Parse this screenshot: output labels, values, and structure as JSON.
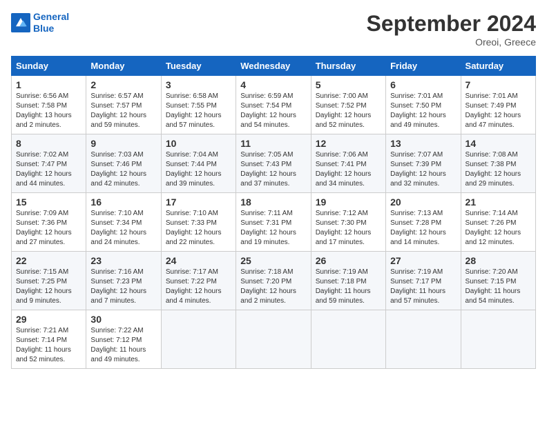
{
  "header": {
    "logo_line1": "General",
    "logo_line2": "Blue",
    "month_title": "September 2024",
    "location": "Oreoi, Greece"
  },
  "weekdays": [
    "Sunday",
    "Monday",
    "Tuesday",
    "Wednesday",
    "Thursday",
    "Friday",
    "Saturday"
  ],
  "weeks": [
    [
      {
        "day": "1",
        "sunrise": "Sunrise: 6:56 AM",
        "sunset": "Sunset: 7:58 PM",
        "daylight": "Daylight: 13 hours and 2 minutes."
      },
      {
        "day": "2",
        "sunrise": "Sunrise: 6:57 AM",
        "sunset": "Sunset: 7:57 PM",
        "daylight": "Daylight: 12 hours and 59 minutes."
      },
      {
        "day": "3",
        "sunrise": "Sunrise: 6:58 AM",
        "sunset": "Sunset: 7:55 PM",
        "daylight": "Daylight: 12 hours and 57 minutes."
      },
      {
        "day": "4",
        "sunrise": "Sunrise: 6:59 AM",
        "sunset": "Sunset: 7:54 PM",
        "daylight": "Daylight: 12 hours and 54 minutes."
      },
      {
        "day": "5",
        "sunrise": "Sunrise: 7:00 AM",
        "sunset": "Sunset: 7:52 PM",
        "daylight": "Daylight: 12 hours and 52 minutes."
      },
      {
        "day": "6",
        "sunrise": "Sunrise: 7:01 AM",
        "sunset": "Sunset: 7:50 PM",
        "daylight": "Daylight: 12 hours and 49 minutes."
      },
      {
        "day": "7",
        "sunrise": "Sunrise: 7:01 AM",
        "sunset": "Sunset: 7:49 PM",
        "daylight": "Daylight: 12 hours and 47 minutes."
      }
    ],
    [
      {
        "day": "8",
        "sunrise": "Sunrise: 7:02 AM",
        "sunset": "Sunset: 7:47 PM",
        "daylight": "Daylight: 12 hours and 44 minutes."
      },
      {
        "day": "9",
        "sunrise": "Sunrise: 7:03 AM",
        "sunset": "Sunset: 7:46 PM",
        "daylight": "Daylight: 12 hours and 42 minutes."
      },
      {
        "day": "10",
        "sunrise": "Sunrise: 7:04 AM",
        "sunset": "Sunset: 7:44 PM",
        "daylight": "Daylight: 12 hours and 39 minutes."
      },
      {
        "day": "11",
        "sunrise": "Sunrise: 7:05 AM",
        "sunset": "Sunset: 7:43 PM",
        "daylight": "Daylight: 12 hours and 37 minutes."
      },
      {
        "day": "12",
        "sunrise": "Sunrise: 7:06 AM",
        "sunset": "Sunset: 7:41 PM",
        "daylight": "Daylight: 12 hours and 34 minutes."
      },
      {
        "day": "13",
        "sunrise": "Sunrise: 7:07 AM",
        "sunset": "Sunset: 7:39 PM",
        "daylight": "Daylight: 12 hours and 32 minutes."
      },
      {
        "day": "14",
        "sunrise": "Sunrise: 7:08 AM",
        "sunset": "Sunset: 7:38 PM",
        "daylight": "Daylight: 12 hours and 29 minutes."
      }
    ],
    [
      {
        "day": "15",
        "sunrise": "Sunrise: 7:09 AM",
        "sunset": "Sunset: 7:36 PM",
        "daylight": "Daylight: 12 hours and 27 minutes."
      },
      {
        "day": "16",
        "sunrise": "Sunrise: 7:10 AM",
        "sunset": "Sunset: 7:34 PM",
        "daylight": "Daylight: 12 hours and 24 minutes."
      },
      {
        "day": "17",
        "sunrise": "Sunrise: 7:10 AM",
        "sunset": "Sunset: 7:33 PM",
        "daylight": "Daylight: 12 hours and 22 minutes."
      },
      {
        "day": "18",
        "sunrise": "Sunrise: 7:11 AM",
        "sunset": "Sunset: 7:31 PM",
        "daylight": "Daylight: 12 hours and 19 minutes."
      },
      {
        "day": "19",
        "sunrise": "Sunrise: 7:12 AM",
        "sunset": "Sunset: 7:30 PM",
        "daylight": "Daylight: 12 hours and 17 minutes."
      },
      {
        "day": "20",
        "sunrise": "Sunrise: 7:13 AM",
        "sunset": "Sunset: 7:28 PM",
        "daylight": "Daylight: 12 hours and 14 minutes."
      },
      {
        "day": "21",
        "sunrise": "Sunrise: 7:14 AM",
        "sunset": "Sunset: 7:26 PM",
        "daylight": "Daylight: 12 hours and 12 minutes."
      }
    ],
    [
      {
        "day": "22",
        "sunrise": "Sunrise: 7:15 AM",
        "sunset": "Sunset: 7:25 PM",
        "daylight": "Daylight: 12 hours and 9 minutes."
      },
      {
        "day": "23",
        "sunrise": "Sunrise: 7:16 AM",
        "sunset": "Sunset: 7:23 PM",
        "daylight": "Daylight: 12 hours and 7 minutes."
      },
      {
        "day": "24",
        "sunrise": "Sunrise: 7:17 AM",
        "sunset": "Sunset: 7:22 PM",
        "daylight": "Daylight: 12 hours and 4 minutes."
      },
      {
        "day": "25",
        "sunrise": "Sunrise: 7:18 AM",
        "sunset": "Sunset: 7:20 PM",
        "daylight": "Daylight: 12 hours and 2 minutes."
      },
      {
        "day": "26",
        "sunrise": "Sunrise: 7:19 AM",
        "sunset": "Sunset: 7:18 PM",
        "daylight": "Daylight: 11 hours and 59 minutes."
      },
      {
        "day": "27",
        "sunrise": "Sunrise: 7:19 AM",
        "sunset": "Sunset: 7:17 PM",
        "daylight": "Daylight: 11 hours and 57 minutes."
      },
      {
        "day": "28",
        "sunrise": "Sunrise: 7:20 AM",
        "sunset": "Sunset: 7:15 PM",
        "daylight": "Daylight: 11 hours and 54 minutes."
      }
    ],
    [
      {
        "day": "29",
        "sunrise": "Sunrise: 7:21 AM",
        "sunset": "Sunset: 7:14 PM",
        "daylight": "Daylight: 11 hours and 52 minutes."
      },
      {
        "day": "30",
        "sunrise": "Sunrise: 7:22 AM",
        "sunset": "Sunset: 7:12 PM",
        "daylight": "Daylight: 11 hours and 49 minutes."
      },
      null,
      null,
      null,
      null,
      null
    ]
  ]
}
